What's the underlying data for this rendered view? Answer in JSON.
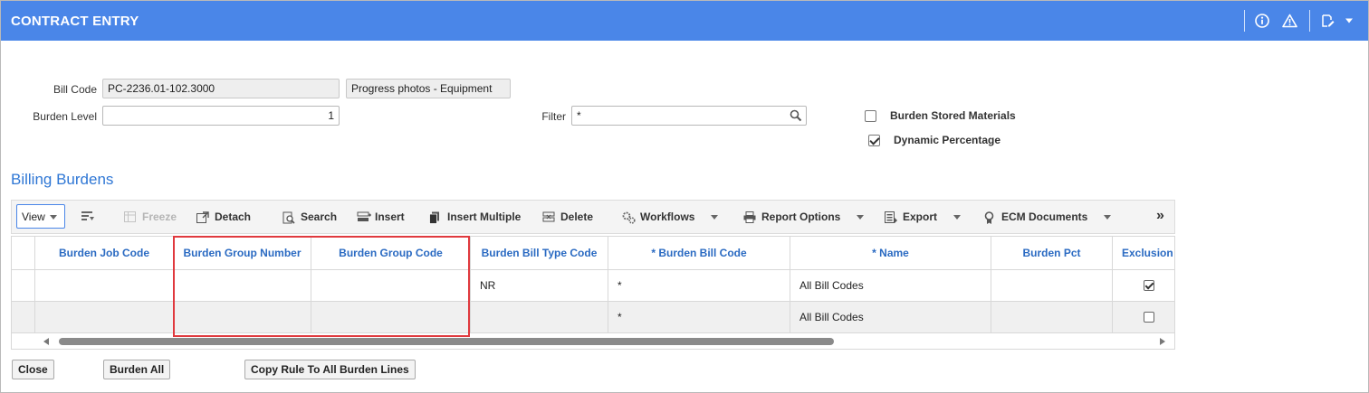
{
  "titlebar": {
    "title": "CONTRACT ENTRY"
  },
  "form": {
    "bill_code_label": "Bill Code",
    "bill_code_value": "PC-2236.01-102.3000",
    "bill_code_desc": "Progress photos - Equipment",
    "burden_level_label": "Burden Level",
    "burden_level_value": "1",
    "filter_label": "Filter",
    "filter_value": "*",
    "burden_stored_label": "Burden Stored Materials",
    "burden_stored_checked": false,
    "dynamic_pct_label": "Dynamic Percentage",
    "dynamic_pct_checked": true
  },
  "section": {
    "title": "Billing Burdens"
  },
  "toolbar": {
    "view": "View",
    "freeze": "Freeze",
    "detach": "Detach",
    "search": "Search",
    "insert": "Insert",
    "insert_multiple": "Insert Multiple",
    "delete": "Delete",
    "workflows": "Workflows",
    "report_options": "Report Options",
    "export": "Export",
    "ecm_documents": "ECM Documents",
    "more": "»"
  },
  "grid": {
    "columns": [
      "Burden Job Code",
      "Burden Group Number",
      "Burden Group Code",
      "Burden Bill Type Code",
      "* Burden Bill Code",
      "* Name",
      "Burden Pct",
      "Exclusion"
    ],
    "rows": [
      {
        "burden_job_code": "",
        "burden_group_number": "",
        "burden_group_code": "",
        "burden_bill_type_code": "NR",
        "burden_bill_code": "*",
        "name": "All Bill Codes",
        "burden_pct": "",
        "exclusion": true
      },
      {
        "burden_job_code": "",
        "burden_group_number": "",
        "burden_group_code": "",
        "burden_bill_type_code": "",
        "burden_bill_code": "*",
        "name": "All Bill Codes",
        "burden_pct": "",
        "exclusion": false
      }
    ]
  },
  "buttons": {
    "close": "Close",
    "burden_all": "Burden All",
    "copy_rule": "Copy Rule To All Burden Lines"
  },
  "colors": {
    "titlebar": "#4a86e8",
    "highlight": "#e0393e",
    "link": "#2a6ac2"
  }
}
